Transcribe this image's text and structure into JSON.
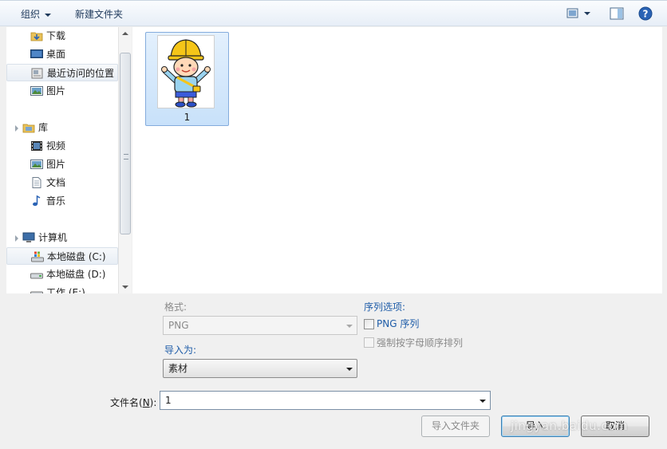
{
  "toolbar": {
    "organize_label": "组织",
    "new_folder_label": "新建文件夹",
    "view_icon": "view-icon",
    "preview_pane_icon": "preview-pane-icon",
    "help_icon": "help-icon"
  },
  "nav": {
    "items": [
      {
        "label": "下载",
        "icon": "download-folder-icon"
      },
      {
        "label": "桌面",
        "icon": "desktop-icon"
      },
      {
        "label": "最近访问的位置",
        "icon": "recent-places-icon"
      },
      {
        "label": "图片",
        "icon": "pictures-icon"
      },
      {
        "label": "库",
        "icon": "libraries-icon"
      },
      {
        "label": "视频",
        "icon": "videos-icon"
      },
      {
        "label": "图片",
        "icon": "pictures-icon"
      },
      {
        "label": "文档",
        "icon": "documents-icon"
      },
      {
        "label": "音乐",
        "icon": "music-icon"
      },
      {
        "label": "计算机",
        "icon": "computer-icon"
      },
      {
        "label": "本地磁盘 (C:)",
        "icon": "system-drive-icon"
      },
      {
        "label": "本地磁盘 (D:)",
        "icon": "drive-icon"
      },
      {
        "label": "工作 (E:)",
        "icon": "drive-icon"
      }
    ]
  },
  "files": [
    {
      "name": "1",
      "thumbnail": "cartoon-boy-thumbnail"
    }
  ],
  "options": {
    "format_label": "格式:",
    "format_value": "PNG",
    "import_as_label": "导入为:",
    "import_as_value": "素材",
    "sequence_options_label": "序列选项:",
    "png_sequence_label": "PNG 序列",
    "force_alpha_label": "强制按字母顺序排列"
  },
  "filename": {
    "label": "文件名(N):",
    "label_prefix": "文件名(",
    "label_key": "N",
    "label_suffix": "):",
    "value": "1"
  },
  "buttons": {
    "import_folder": "导入文件夹",
    "import": "导入",
    "cancel": "取消"
  },
  "watermark": "jingyan.baidu.com"
}
